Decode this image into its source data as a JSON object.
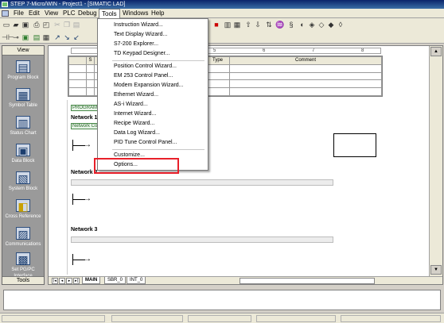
{
  "window": {
    "title": "STEP 7-Micro/WIN - Project1 - [SIMATIC LAD]"
  },
  "menu": {
    "items": [
      {
        "label": "File"
      },
      {
        "label": "Edit"
      },
      {
        "label": "View"
      },
      {
        "label": "PLC"
      },
      {
        "label": "Debug"
      },
      {
        "label": "Tools"
      },
      {
        "label": "Windows"
      },
      {
        "label": "Help"
      }
    ]
  },
  "tools_menu": {
    "items": [
      {
        "label": "Instruction Wizard..."
      },
      {
        "label": "Text Display Wizard..."
      },
      {
        "label": "S7-200 Explorer..."
      },
      {
        "label": "TD Keypad Designer..."
      },
      {
        "label": "Position Control Wizard..."
      },
      {
        "label": "EM 253 Control Panel..."
      },
      {
        "label": "Modem Expansion Wizard..."
      },
      {
        "label": "Ethernet Wizard..."
      },
      {
        "label": "AS-i Wizard..."
      },
      {
        "label": "Internet Wizard..."
      },
      {
        "label": "Recipe Wizard..."
      },
      {
        "label": "Data Log Wizard..."
      },
      {
        "label": "PID Tune Control Panel..."
      },
      {
        "label": "Customize..."
      },
      {
        "label": "Options..."
      }
    ],
    "highlighted": "Options..."
  },
  "navigation": {
    "header": "View",
    "items": [
      {
        "label": "Program Block",
        "icon": "program-block-icon"
      },
      {
        "label": "Symbol Table",
        "icon": "symbol-table-icon"
      },
      {
        "label": "Status Chart",
        "icon": "status-chart-icon"
      },
      {
        "label": "Data Block",
        "icon": "data-block-icon"
      },
      {
        "label": "System Block",
        "icon": "system-block-icon"
      },
      {
        "label": "Cross Reference",
        "icon": "cross-reference-icon"
      },
      {
        "label": "Communications",
        "icon": "communications-icon"
      },
      {
        "label": "Set PG/PC Interface",
        "icon": "set-pg-pc-icon"
      }
    ],
    "footer": "Tools"
  },
  "editor": {
    "ruler_marks": [
      "5",
      "6",
      "7",
      "8"
    ],
    "variable_table": {
      "headers": [
        "S",
        "Type",
        "Comment"
      ]
    },
    "program_comment": "PROGRAM",
    "networks": [
      {
        "label": "Network 1",
        "comment": "Network Co"
      },
      {
        "label": "Network 2"
      },
      {
        "label": "Network 3"
      }
    ],
    "tabs": [
      {
        "label": "MAIN",
        "active": true
      },
      {
        "label": "SBR_0",
        "active": false
      },
      {
        "label": "INT_0",
        "active": false
      }
    ]
  },
  "colors": {
    "titlebar": "#0a246a",
    "highlight_box": "#e8202a",
    "nav_bg": "#9a9a9a"
  }
}
